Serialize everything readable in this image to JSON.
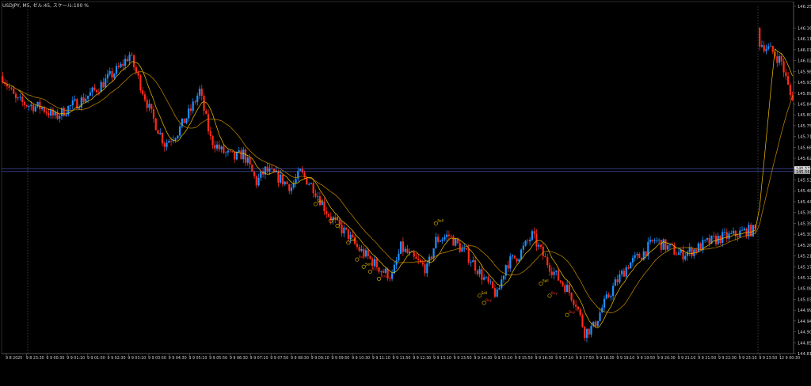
{
  "header": {
    "text": "USDJPY, M5, ゼル:45, スケール:100 %"
  },
  "chart_data": {
    "type": "candlestick",
    "symbol": "USDJPY",
    "timeframe": "M5",
    "ylim": [
      144.81,
      146.25
    ],
    "yticks": [
      "146.250",
      "146.160",
      "146.115",
      "146.070",
      "146.025",
      "145.980",
      "145.935",
      "145.890",
      "145.845",
      "145.800",
      "145.755",
      "145.710",
      "145.665",
      "145.620",
      "145.575",
      "145.530",
      "145.485",
      "145.440",
      "145.395",
      "145.350",
      "145.305",
      "145.260",
      "145.215",
      "145.170",
      "145.125",
      "145.080",
      "145.035",
      "144.990",
      "144.945",
      "144.900",
      "144.855",
      "144.810"
    ],
    "xticks": [
      "9 8 2025",
      "9 8 23:30",
      "9 9 00:30",
      "9 9 01:10",
      "9 9 01:50",
      "9 9 02:30",
      "9 9 03:10",
      "9 9 03:50",
      "9 9 04:30",
      "9 9 05:10",
      "9 9 05:50",
      "9 9 06:30",
      "9 9 07:10",
      "9 9 07:50",
      "9 9 08:30",
      "9 9 09:10",
      "9 9 09:50",
      "9 9 10:30",
      "9 9 11:10",
      "9 9 11:50",
      "9 9 12:30",
      "9 9 13:10",
      "9 9 13:50",
      "9 9 14:30",
      "9 9 15:10",
      "9 9 15:50",
      "9 9 16:30",
      "9 9 17:10",
      "9 9 17:50",
      "9 9 18:30",
      "9 9 19:10",
      "9 9 19:50",
      "9 9 20:30",
      "9 9 21:10",
      "9 9 21:50",
      "9 9 22:30",
      "9 9 23:10",
      "9 9 23:50",
      "12 9 00:30"
    ],
    "price_labels": [
      "145.577",
      "145.565"
    ],
    "signal_labels": [
      "Sell",
      "Buy"
    ],
    "colors": {
      "bull": "#1e90ff",
      "bear": "#ff2a1a",
      "ma_fast": "#f2c200",
      "ma_slow": "#c98a00",
      "grid": "#2a2a2a",
      "text": "#d0d0d0",
      "hline": "#5060d0"
    },
    "path_points": [
      [
        0,
        145.96
      ],
      [
        6,
        145.86
      ],
      [
        12,
        145.84
      ],
      [
        18,
        145.83
      ],
      [
        24,
        145.79
      ],
      [
        30,
        145.83
      ],
      [
        36,
        145.86
      ],
      [
        42,
        145.9
      ],
      [
        48,
        145.95
      ],
      [
        54,
        146.0
      ],
      [
        58,
        146.05
      ],
      [
        62,
        145.95
      ],
      [
        68,
        145.8
      ],
      [
        74,
        145.68
      ],
      [
        80,
        145.73
      ],
      [
        86,
        145.82
      ],
      [
        90,
        145.9
      ],
      [
        95,
        145.7
      ],
      [
        100,
        145.65
      ],
      [
        106,
        145.62
      ],
      [
        110,
        145.64
      ],
      [
        116,
        145.52
      ],
      [
        120,
        145.57
      ],
      [
        126,
        145.54
      ],
      [
        132,
        145.5
      ],
      [
        136,
        145.56
      ],
      [
        142,
        145.5
      ],
      [
        148,
        145.4
      ],
      [
        152,
        145.35
      ],
      [
        158,
        145.3
      ],
      [
        162,
        145.25
      ],
      [
        168,
        145.2
      ],
      [
        174,
        145.15
      ],
      [
        178,
        145.13
      ],
      [
        182,
        145.25
      ],
      [
        188,
        145.2
      ],
      [
        194,
        145.16
      ],
      [
        198,
        145.28
      ],
      [
        204,
        145.3
      ],
      [
        210,
        145.24
      ],
      [
        214,
        145.2
      ],
      [
        220,
        145.12
      ],
      [
        226,
        145.05
      ],
      [
        230,
        145.18
      ],
      [
        236,
        145.22
      ],
      [
        242,
        145.3
      ],
      [
        248,
        145.2
      ],
      [
        254,
        145.12
      ],
      [
        258,
        145.08
      ],
      [
        262,
        145.02
      ],
      [
        266,
        144.9
      ],
      [
        270,
        144.92
      ],
      [
        274,
        145.0
      ],
      [
        280,
        145.1
      ],
      [
        286,
        145.18
      ],
      [
        292,
        145.22
      ],
      [
        298,
        145.28
      ],
      [
        304,
        145.25
      ],
      [
        310,
        145.22
      ],
      [
        316,
        145.24
      ],
      [
        322,
        145.27
      ],
      [
        328,
        145.29
      ],
      [
        334,
        145.3
      ],
      [
        340,
        145.32
      ],
      [
        344,
        145.32
      ],
      [
        346,
        146.1
      ],
      [
        352,
        146.06
      ],
      [
        356,
        146.02
      ],
      [
        360,
        145.88
      ]
    ],
    "signals": [
      {
        "text": "Sell",
        "i": 143,
        "price": 145.43
      },
      {
        "text": "Sell",
        "i": 150,
        "price": 145.36
      },
      {
        "text": "Buy",
        "i": 153,
        "price": 145.34
      },
      {
        "text": "Sell",
        "i": 158,
        "price": 145.27
      },
      {
        "text": "Buy",
        "i": 162,
        "price": 145.2
      },
      {
        "text": "Sell",
        "i": 165,
        "price": 145.17
      },
      {
        "text": "Buy",
        "i": 168,
        "price": 145.15
      },
      {
        "text": "Buy",
        "i": 172,
        "price": 145.12
      },
      {
        "text": "Sell",
        "i": 198,
        "price": 145.35
      },
      {
        "text": "Sell",
        "i": 218,
        "price": 145.05
      },
      {
        "text": "Buy",
        "i": 220,
        "price": 145.02
      },
      {
        "text": "Sell",
        "i": 246,
        "price": 145.1
      },
      {
        "text": "Buy",
        "i": 250,
        "price": 145.05
      },
      {
        "text": "Buy",
        "i": 258,
        "price": 144.97
      }
    ]
  }
}
